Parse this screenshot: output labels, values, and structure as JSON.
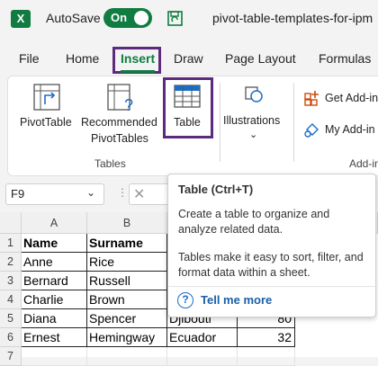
{
  "titlebar": {
    "logo": "X",
    "autosave_label": "AutoSave",
    "autosave_state": "On",
    "doc_title": "pivot-table-templates-for-ipm"
  },
  "tabs": [
    "File",
    "Home",
    "Insert",
    "Draw",
    "Page Layout",
    "Formulas"
  ],
  "ribbon": {
    "pivottable": "PivotTable",
    "recommended_1": "Recommended",
    "recommended_2": "PivotTables",
    "table": "Table",
    "illustrations": "Illustrations",
    "get_addins": "Get Add-in",
    "my_addins": "My Add-in",
    "group_tables": "Tables",
    "group_addins": "Add-in"
  },
  "formula": {
    "namebox": "F9",
    "namebox_chevron": "⌄",
    "separator": "⋮",
    "cancel": "✕"
  },
  "columns": [
    "A",
    "B"
  ],
  "rows": [
    {
      "n": "1",
      "a": "Name",
      "b": "Surname",
      "c": "",
      "d": ""
    },
    {
      "n": "2",
      "a": "Anne",
      "b": "Rice",
      "c": "",
      "d": ""
    },
    {
      "n": "3",
      "a": "Bernard",
      "b": "Russell",
      "c": "",
      "d": ""
    },
    {
      "n": "4",
      "a": "Charlie",
      "b": "Brown",
      "c": "",
      "d": ""
    },
    {
      "n": "5",
      "a": "Diana",
      "b": "Spencer",
      "c": "Djibouti",
      "d": "80"
    },
    {
      "n": "6",
      "a": "Ernest",
      "b": "Hemingway",
      "c": "Ecuador",
      "d": "32"
    },
    {
      "n": "7",
      "a": "",
      "b": "",
      "c": "",
      "d": ""
    }
  ],
  "tooltip": {
    "title": "Table (Ctrl+T)",
    "line1": "Create a table to organize and analyze related data.",
    "line2": "Tables make it easy to sort, filter, and format data within a sheet.",
    "help_glyph": "?",
    "tell_me_more": "Tell me more"
  }
}
